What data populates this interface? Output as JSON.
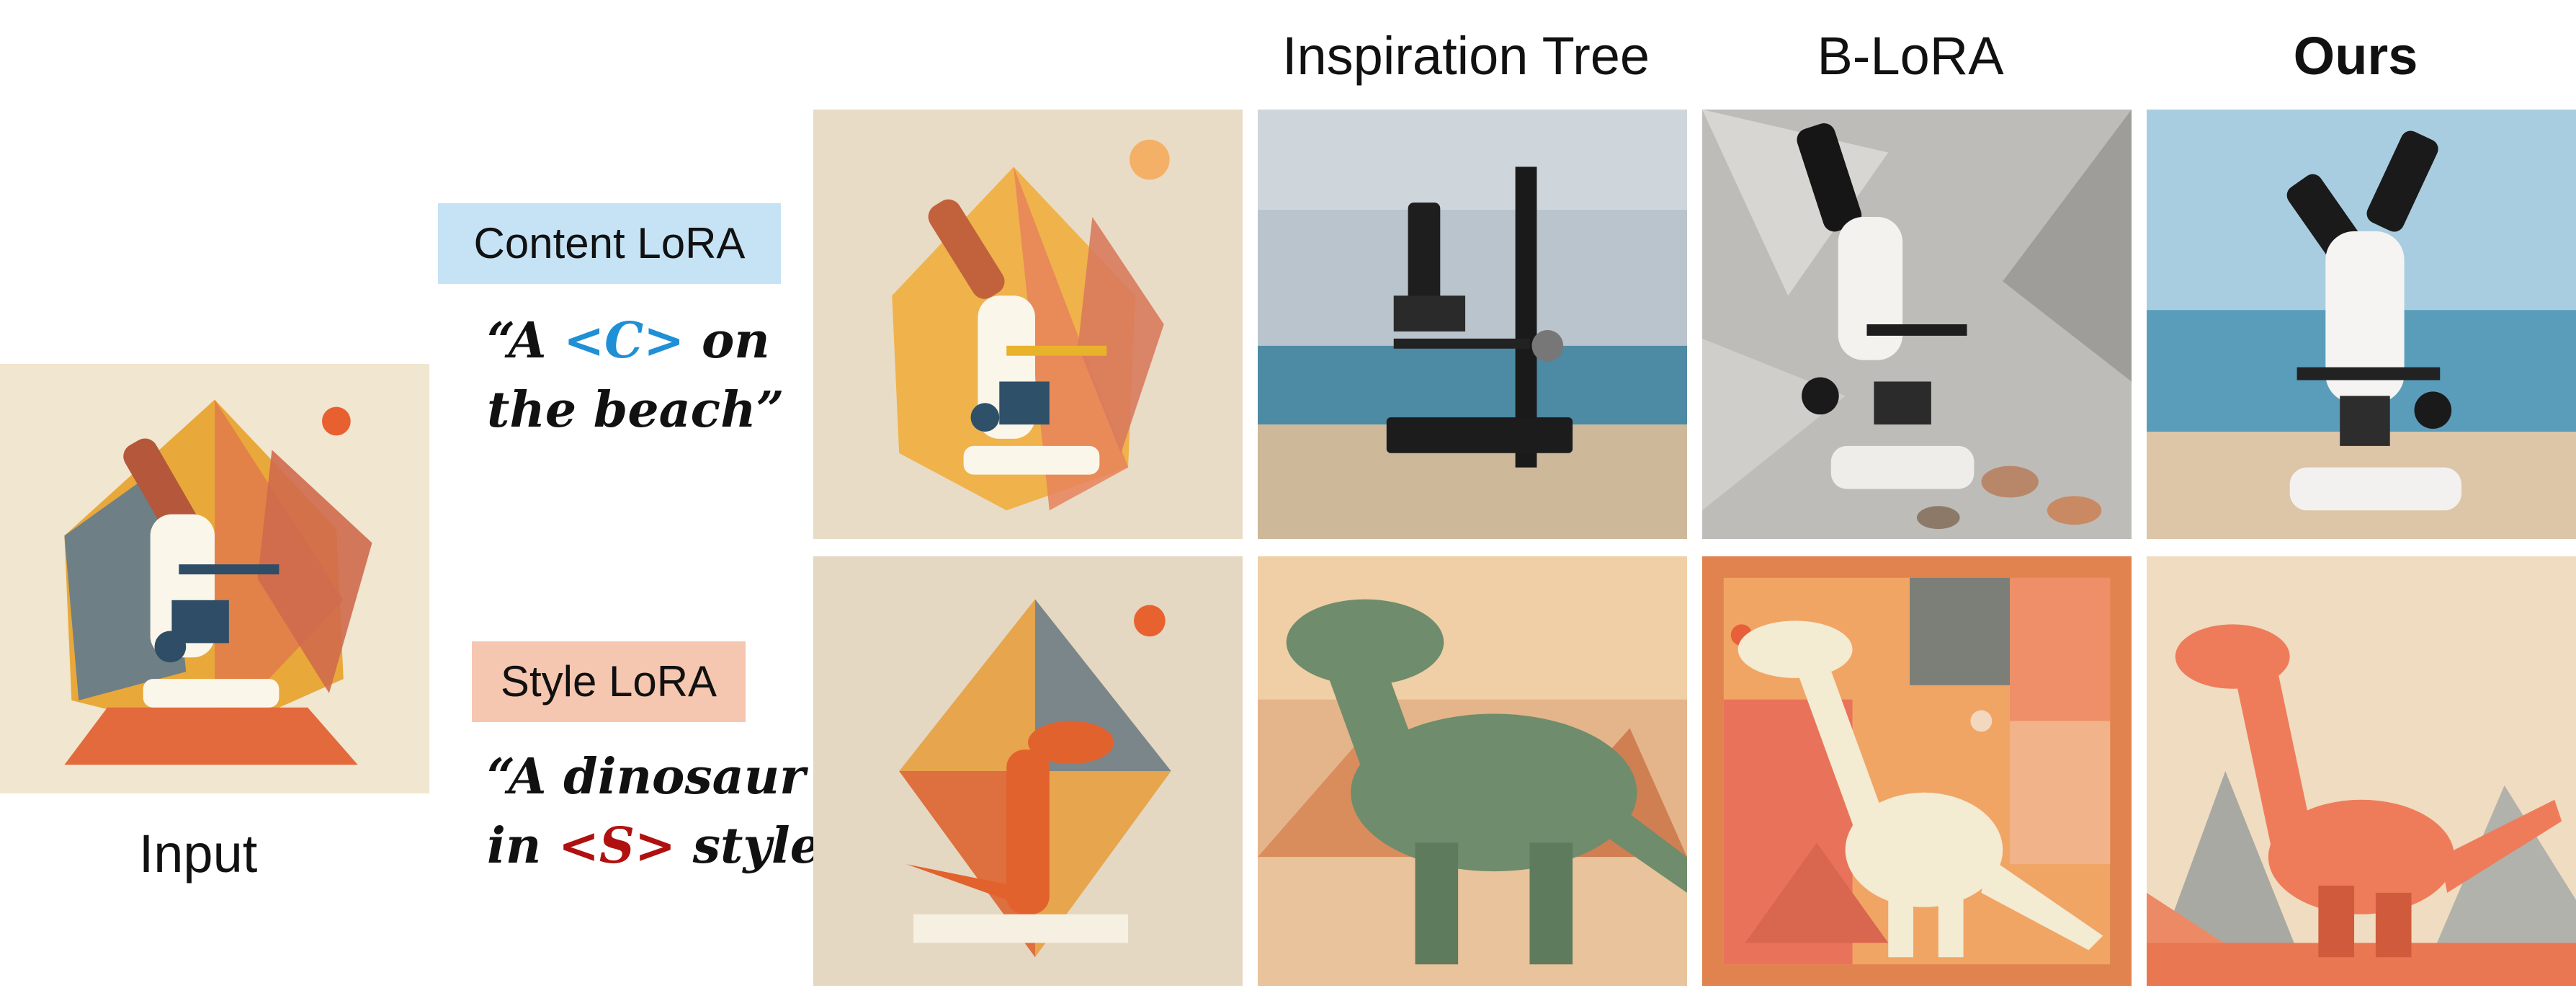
{
  "columns": {
    "inspiration_tree": "Inspiration Tree",
    "b_lora": "B-LoRA",
    "ours": "Ours"
  },
  "input_label": "Input",
  "rows": [
    {
      "tag": "Content LoRA",
      "tag_color": "#c6e3f5",
      "prompt_line1_open": "“A ",
      "prompt_token": "<C>",
      "prompt_token_color": "#1f8fd6",
      "prompt_line1_close": " on",
      "prompt_line2": "the beach”"
    },
    {
      "tag": "Style LoRA",
      "tag_color": "#f6c7b0",
      "prompt_line1": "“A dinosaur",
      "prompt_line2_open": "in ",
      "prompt_token": "<S>",
      "prompt_token_color": "#b01010",
      "prompt_line2_close": " style”"
    }
  ],
  "images": {
    "input": "geometric-style microscope illustration",
    "row1": [
      "geometric microscope illustration",
      "photo of black microscope on beach",
      "photo of white microscope with shells",
      "photo of white microscope on beach"
    ],
    "row2": [
      "geometric orange dinosaur on diamond",
      "green cartoon dinosaur in desert",
      "cream dinosaur on geometric orange background",
      "flat orange dinosaur with mountains"
    ]
  }
}
